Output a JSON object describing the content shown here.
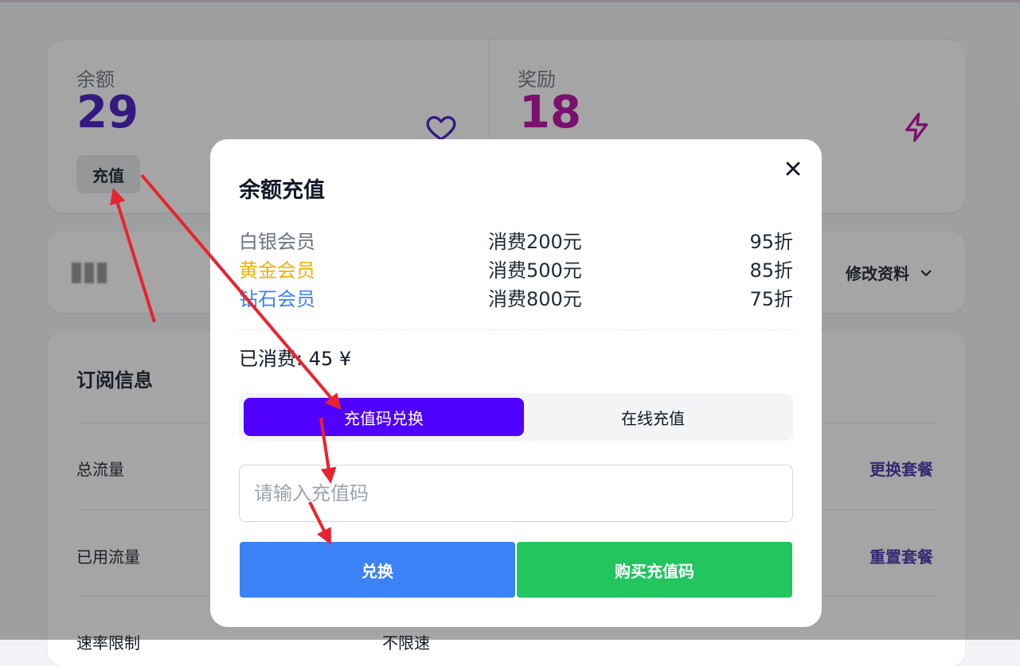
{
  "stats": {
    "balance_label": "余额",
    "balance_value": "29",
    "recharge_label": "充值",
    "reward_label": "奖励",
    "reward_value": "18"
  },
  "profile": {
    "edit_label": "修改资料"
  },
  "subscription": {
    "title": "订阅信息",
    "rows": [
      {
        "label": "总流量",
        "action": "更换套餐"
      },
      {
        "label": "已用流量",
        "action": "重置套餐"
      },
      {
        "label": "速率限制",
        "value": "不限速"
      }
    ]
  },
  "modal": {
    "title": "余额充值",
    "tiers": [
      {
        "name": "白银会员",
        "condition": "消费200元",
        "discount": "95折",
        "color": "#6b7280"
      },
      {
        "name": "黄金会员",
        "condition": "消费500元",
        "discount": "85折",
        "color": "#eab308"
      },
      {
        "name": "钻石会员",
        "condition": "消费800元",
        "discount": "75折",
        "color": "#3b82f6"
      }
    ],
    "spent_text": "已消费: 45 ¥",
    "tabs": [
      {
        "label": "充值码兑换",
        "active": true
      },
      {
        "label": "在线充值",
        "active": false
      }
    ],
    "input_placeholder": "请输入充值码",
    "redeem_label": "兑换",
    "buy_code_label": "购买充值码"
  },
  "colors": {
    "balance": "#3b0fbf",
    "reward": "#b3009f",
    "tab_active": "#4f00ff",
    "redeem_button": "#3b82f6",
    "buy_button": "#22c55e",
    "annotation_arrow": "#e8232f"
  },
  "icons": {
    "balance_icon": "heart-icon",
    "reward_icon": "lightning-icon",
    "close_icon": "close-icon",
    "dropdown_icon": "chevron-down-icon"
  }
}
